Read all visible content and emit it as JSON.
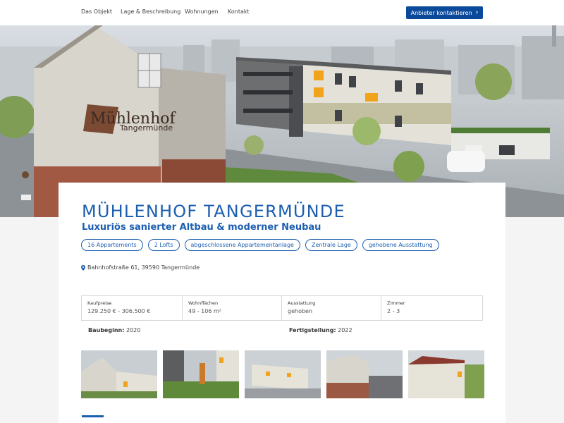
{
  "nav": {
    "items": [
      "Das Objekt",
      "Lage & Beschreibung",
      "Wohnungen",
      "Kontakt"
    ],
    "cta_label": "Anbieter kontaktieren"
  },
  "hero": {
    "logo_text_main": "Mühlenhof",
    "logo_text_sub": "Tangermünde"
  },
  "listing": {
    "title": "MÜHLENHOF TANGERMÜNDE",
    "subtitle": "Luxuriös sanierter Altbau & moderner Neubau",
    "tags": [
      "16 Appartements",
      "2 Lofts",
      "abgeschlossene Appartementanlage",
      "Zentrale Lage",
      "gehobene Ausstattung"
    ],
    "address": "Bahnhofstraße 61, 39590 Tangermünde",
    "facts": [
      {
        "label": "Kaufpreise",
        "value": "129.250 € - 306.500 €"
      },
      {
        "label": "Wohnflächen",
        "value": "49 - 106 m²"
      },
      {
        "label": "Ausstattung",
        "value": "gehoben"
      },
      {
        "label": "Zimmer",
        "value": "2 - 3"
      }
    ],
    "baubeginn_label": "Baubeginn:",
    "baubeginn_value": "2020",
    "fertigstellung_label": "Fertigstellung:",
    "fertigstellung_value": "2022"
  },
  "colors": {
    "accent": "#1c5fb0",
    "cta_bg": "#0b4a9b"
  },
  "icons": {
    "address": "map-pin-icon",
    "cta": "chevron-right-icon"
  }
}
